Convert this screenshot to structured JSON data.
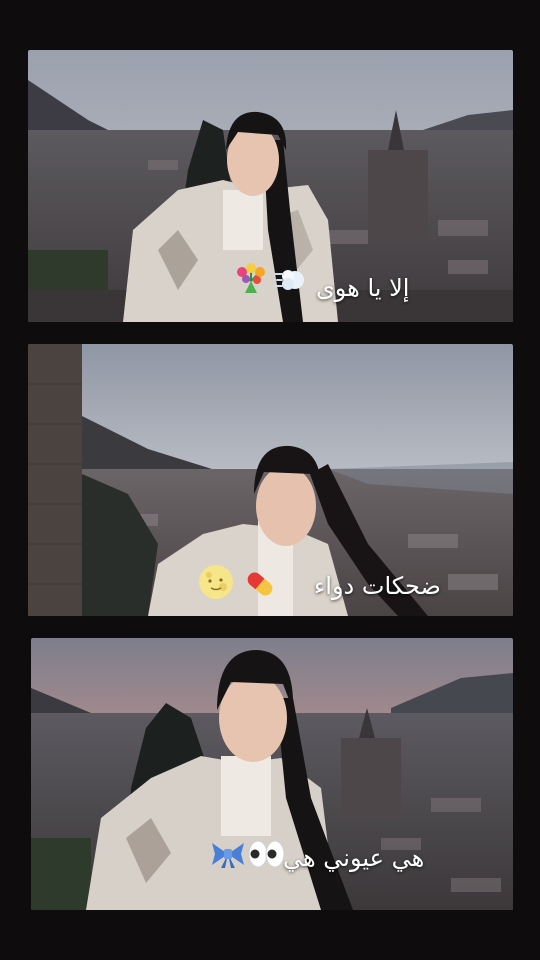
{
  "story": {
    "panels": [
      {
        "caption": "إلا يا هوى",
        "emojis": [
          "tulip-bouquet",
          "dash-puff"
        ]
      },
      {
        "caption": "ضحكات دواء",
        "emojis": [
          "full-moon-face",
          "pill"
        ]
      },
      {
        "caption": "هي عيوني هي",
        "emojis": [
          "blue-ribbon",
          "eyes"
        ]
      }
    ]
  },
  "colors": {
    "background": "#0e0c0c",
    "caption_text": "#ffffff"
  }
}
